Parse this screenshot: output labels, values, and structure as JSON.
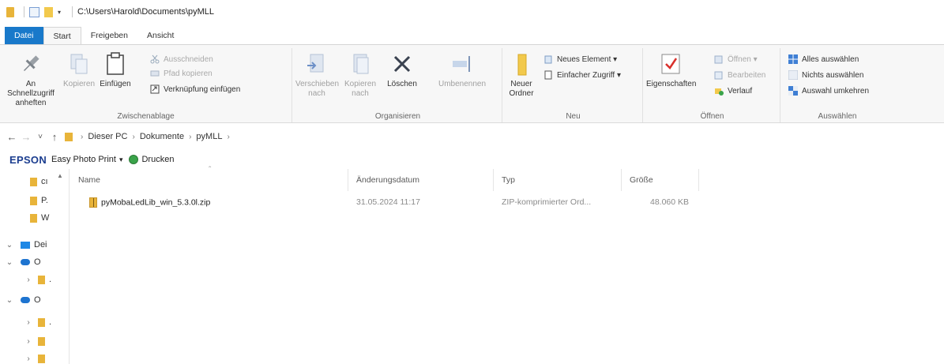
{
  "window": {
    "title_path": "C:\\Users\\Harold\\Documents\\pyMLL",
    "quick_access_dropdown": "▾"
  },
  "ribbon_tabs": [
    "Datei",
    "Start",
    "Freigeben",
    "Ansicht"
  ],
  "ribbon": {
    "clipboard": {
      "group_label": "Zwischenablage",
      "pin_label": "An Schnellzugriff anheften",
      "copy_label": "Kopieren",
      "paste_label": "Einfügen",
      "cut_label": "Ausschneiden",
      "copy_path_label": "Pfad kopieren",
      "paste_shortcut_label": "Verknüpfung einfügen"
    },
    "organize": {
      "group_label": "Organisieren",
      "move_label": "Verschieben nach",
      "copy_to_label": "Kopieren nach",
      "delete_label": "Löschen",
      "rename_label": "Umbenennen"
    },
    "new": {
      "group_label": "Neu",
      "new_folder_label": "Neuer Ordner",
      "new_item_label": "Neues Element ▾",
      "easy_access_label": "Einfacher Zugriff ▾"
    },
    "open": {
      "group_label": "Öffnen",
      "properties_label": "Eigenschaften",
      "open_label": "Öffnen ▾",
      "edit_label": "Bearbeiten",
      "history_label": "Verlauf"
    },
    "select": {
      "group_label": "Auswählen",
      "select_all_label": "Alles auswählen",
      "select_none_label": "Nichts auswählen",
      "invert_label": "Auswahl umkehren"
    }
  },
  "address": {
    "back": "←",
    "forward": "→",
    "recent": "˅",
    "up": "↑",
    "crumbs": [
      "Dieser PC",
      "Dokumente",
      "pyMLL"
    ],
    "separator": "›"
  },
  "epson": {
    "logo": "EPSON",
    "app_label": "Easy Photo Print",
    "dropdown": "▾",
    "print_label": "Drucken"
  },
  "nav_pane": {
    "items": [
      {
        "label": "cı",
        "icon": "folder-icon"
      },
      {
        "label": "P.",
        "icon": "folder-icon"
      },
      {
        "label": "W",
        "icon": "folder-icon"
      },
      {
        "label": "Dei",
        "icon": "pc-icon"
      },
      {
        "label": "O",
        "icon": "cloud-icon"
      },
      {
        "label": ".",
        "icon": "folder-icon"
      },
      {
        "label": "O",
        "icon": "cloud-icon"
      },
      {
        "label": ".",
        "icon": "folder-icon"
      },
      {
        "label": "",
        "icon": "folder-icon"
      },
      {
        "label": "",
        "icon": "folder-icon"
      }
    ]
  },
  "file_list": {
    "columns": [
      "Name",
      "Änderungsdatum",
      "Typ",
      "Größe"
    ],
    "sort_caret": "ˆ",
    "rows": [
      {
        "name": "pyMobaLedLib_win_5.3.0l.zip",
        "modified": "31.05.2024 11:17",
        "type": "ZIP-komprimierter Ord...",
        "size": "48.060 KB"
      }
    ]
  },
  "colors": {
    "accent": "#1979ca",
    "folder": "#e8b43a",
    "epson_blue": "#1b3d8f"
  }
}
